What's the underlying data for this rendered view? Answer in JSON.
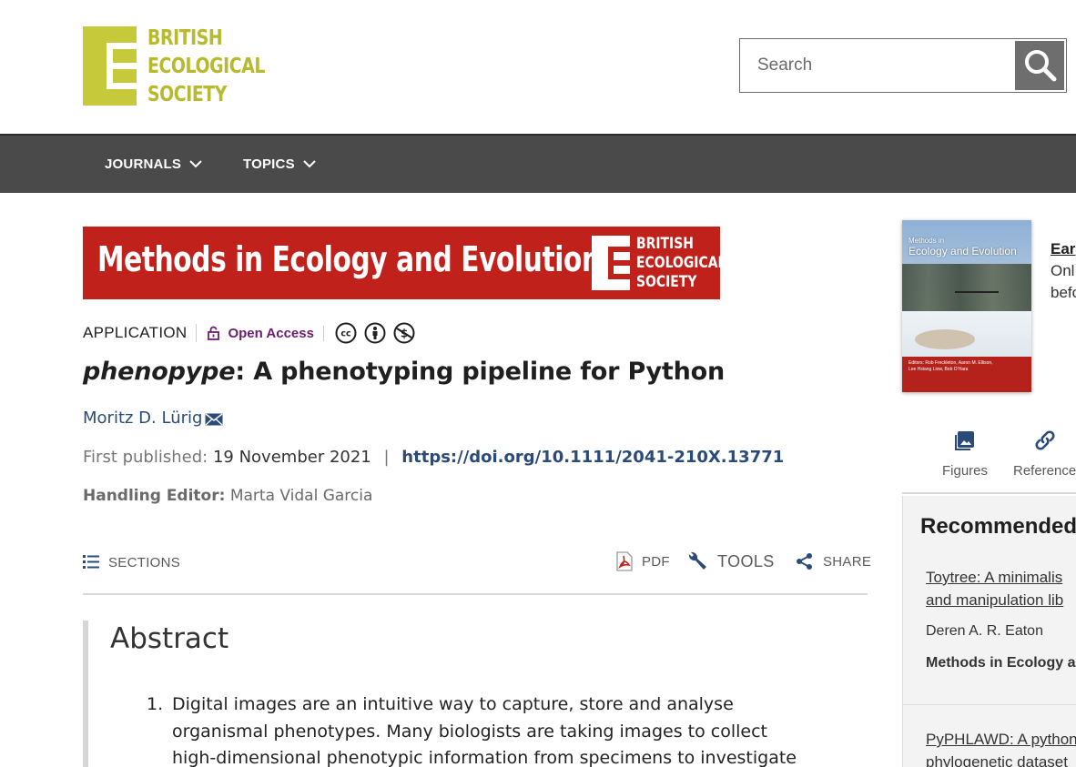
{
  "header": {
    "logo_lines": [
      "BRITISH",
      "ECOLOGICAL",
      "SOCIETY"
    ],
    "search_placeholder": "Search",
    "search_icon": "magnifier-icon"
  },
  "nav": {
    "items": [
      {
        "label": "JOURNALS",
        "icon": "chevron-down-icon"
      },
      {
        "label": "TOPICS",
        "icon": "chevron-down-icon"
      }
    ]
  },
  "banner": {
    "journal_title": "Methods in Ecology and Evolution",
    "logo_lines": [
      "BRITISH",
      "ECOLOGICAL",
      "SOCIETY"
    ],
    "color": "#c0221b"
  },
  "article": {
    "type": "APPLICATION",
    "access": "Open Access",
    "license_icons": [
      "cc-icon",
      "by-icon",
      "nc-icon"
    ],
    "title_italic": "phenopype",
    "title_rest": ": A phenotyping pipeline for Python",
    "author": "Moritz D. Lürig",
    "first_published_label": "First published:",
    "first_published_date": "19 November 2021",
    "separator": "|",
    "doi": "https://doi.org/10.1111/2041-210X.13771",
    "editor_label": "Handling Editor:",
    "editor_name": "Marta Vidal Garcia"
  },
  "toolbar": {
    "sections": "SECTIONS",
    "pdf": "PDF",
    "tools": "TOOLS",
    "share": "SHARE"
  },
  "abstract": {
    "heading": "Abstract",
    "items": [
      {
        "num": "1.",
        "text": "Digital images are an intuitive way to capture, store and analyse organismal phenotypes. Many biologists are taking images to collect high-dimensional phenotypic information from specimens to investigate complex ecological,"
      }
    ]
  },
  "sidebar": {
    "cover": {
      "title_small": "Methods in",
      "title": "Ecology and Evolution",
      "editors": "Editors: Rob Freckleton, Aaron M. Ellison, Lee Hsiang Liow, Bob O'Hara"
    },
    "clip_link": "Ear",
    "clip_text_1": "Onl",
    "clip_text_2": "befo",
    "tabs": [
      {
        "label": "Figures",
        "icon": "image-icon"
      },
      {
        "label": "Reference",
        "icon": "link-icon"
      }
    ],
    "recommended_heading": "Recommended",
    "recommended": [
      {
        "title_1": "Toytree: A minimalis",
        "title_2": "and manipulation lib",
        "author": "Deren A. R. Eaton",
        "journal": "Methods in Ecology a"
      },
      {
        "title_1": "PyPHLAWD: A python",
        "title_2": "phylogenetic dataset"
      }
    ]
  }
}
